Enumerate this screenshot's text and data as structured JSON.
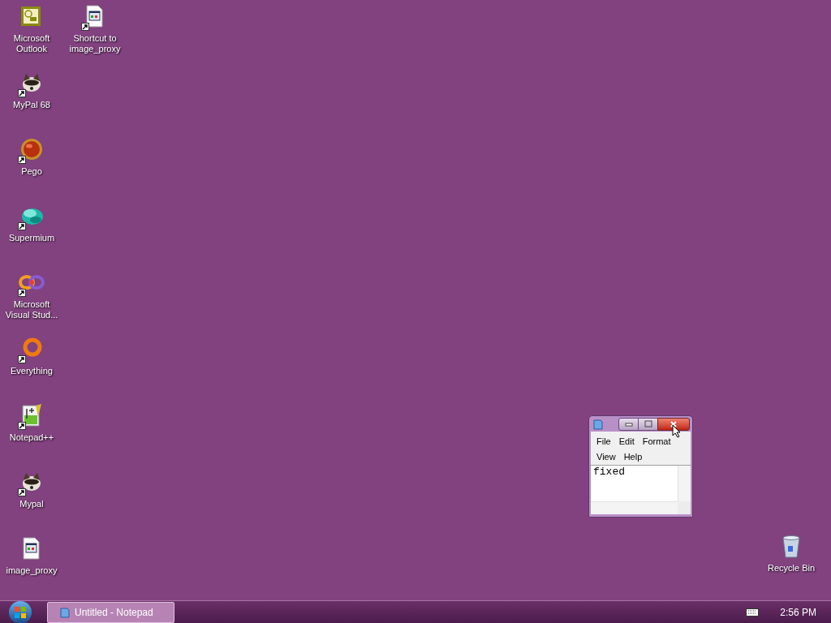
{
  "desktop": {
    "columns": [
      [
        {
          "label": "Microsoft Outlook",
          "kind": "outlook",
          "shortcut": false
        },
        {
          "label": "MyPal 68",
          "kind": "raccoon",
          "shortcut": true
        },
        {
          "label": "Pego",
          "kind": "orb",
          "shortcut": true
        },
        {
          "label": "Supermium",
          "kind": "cloud",
          "shortcut": true
        },
        {
          "label": "Microsoft Visual Stud...",
          "kind": "infinity",
          "shortcut": true
        },
        {
          "label": "Everything",
          "kind": "ring",
          "shortcut": true
        },
        {
          "label": "Notepad++",
          "kind": "notepadpp",
          "shortcut": true
        },
        {
          "label": "Mypal",
          "kind": "raccoon",
          "shortcut": true
        },
        {
          "label": "image_proxy",
          "kind": "document",
          "shortcut": false
        }
      ],
      [
        {
          "label": "Shortcut to image_proxy",
          "kind": "document",
          "shortcut": true
        }
      ]
    ],
    "recycle_bin": {
      "label": "Recycle Bin",
      "kind": "bin",
      "shortcut": false
    }
  },
  "notepad": {
    "menu": [
      "File",
      "Edit",
      "Format",
      "View",
      "Help"
    ],
    "content": "fixed",
    "close_hovered": true
  },
  "taskbar": {
    "tasks": [
      {
        "label": "Untitled - Notepad",
        "selected": true
      }
    ],
    "clock": "2:56 PM"
  }
}
